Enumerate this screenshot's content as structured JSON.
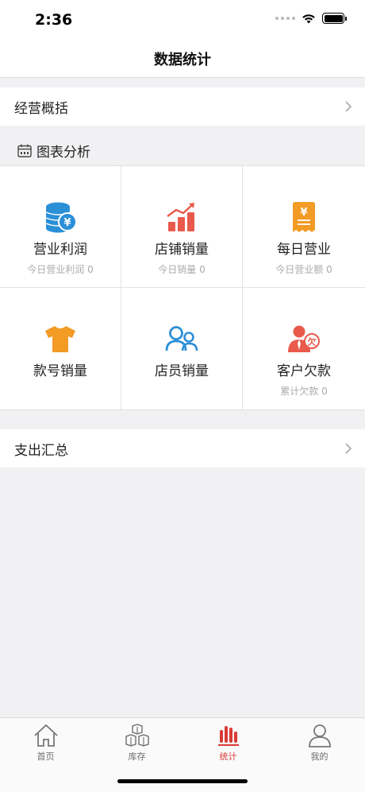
{
  "status_bar": {
    "time": "2:36"
  },
  "nav": {
    "title": "数据统计"
  },
  "overview_row": {
    "label": "经营概括"
  },
  "chart_section": {
    "title": "图表分析",
    "items": [
      {
        "title": "营业利润",
        "subtitle": "今日营业利润  0",
        "icon": "coins-yen-icon",
        "color": "#2b8fd8"
      },
      {
        "title": "店铺销量",
        "subtitle": "今日销量  0",
        "icon": "bar-chart-trend-icon",
        "color": "#e95a4c"
      },
      {
        "title": "每日营业",
        "subtitle": "今日营业额  0",
        "icon": "receipt-yen-icon",
        "color": "#f29b25"
      },
      {
        "title": "款号销量",
        "subtitle": "",
        "icon": "tshirt-icon",
        "color": "#f29b25"
      },
      {
        "title": "店员销量",
        "subtitle": "",
        "icon": "users-icon",
        "color": "#2b8fd8"
      },
      {
        "title": "客户欠款",
        "subtitle": "累计欠款  0",
        "icon": "customer-debt-icon",
        "color": "#e95a4c"
      }
    ]
  },
  "expense_row": {
    "label": "支出汇总"
  },
  "tab_bar": {
    "tabs": [
      {
        "label": "首页",
        "icon": "home-icon",
        "active": false
      },
      {
        "label": "库存",
        "icon": "boxes-icon",
        "active": false
      },
      {
        "label": "统计",
        "icon": "stats-bars-icon",
        "active": true
      },
      {
        "label": "我的",
        "icon": "user-icon",
        "active": false
      }
    ],
    "active_color": "#d83b35",
    "inactive_color": "#6d6d6d"
  }
}
